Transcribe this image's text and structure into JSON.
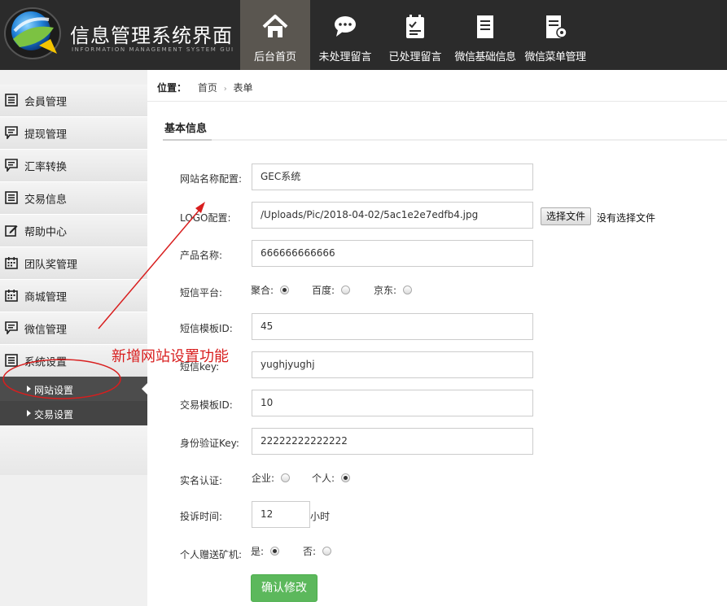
{
  "header": {
    "title": "信息管理系统界面",
    "subtitle": "INFORMATION MANAGEMENT SYSTEM GUI",
    "nav": [
      {
        "label": "后台首页",
        "icon": "home-icon",
        "active": true
      },
      {
        "label": "未处理留言",
        "icon": "chat-icon",
        "active": false
      },
      {
        "label": "已处理留言",
        "icon": "checklist-icon",
        "active": false
      },
      {
        "label": "微信基础信息",
        "icon": "document-icon",
        "active": false
      },
      {
        "label": "微信菜单管理",
        "icon": "doc-settings-icon",
        "active": false
      }
    ]
  },
  "sidebar": {
    "items": [
      {
        "label": "会員管理",
        "icon": "list-icon"
      },
      {
        "label": "提现管理",
        "icon": "comment-icon"
      },
      {
        "label": "汇率转换",
        "icon": "comment-icon"
      },
      {
        "label": "交易信息",
        "icon": "list-icon"
      },
      {
        "label": "帮助中心",
        "icon": "edit-icon"
      },
      {
        "label": "团队奖管理",
        "icon": "calendar-icon"
      },
      {
        "label": "商城管理",
        "icon": "calendar-icon"
      },
      {
        "label": "微信管理",
        "icon": "comment-icon"
      },
      {
        "label": "系统设置",
        "icon": "list-icon"
      }
    ],
    "subitems": [
      {
        "label": "网站设置",
        "active": true
      },
      {
        "label": "交易设置",
        "active": false
      }
    ]
  },
  "breadcrumb": {
    "position_label": "位置：",
    "home": "首页",
    "sep": "›",
    "current": "表单"
  },
  "section": {
    "title": "基本信息"
  },
  "form": {
    "site_name": {
      "label": "网站名称配置:",
      "value": "GEC系统"
    },
    "logo": {
      "label": "LOGO配置:",
      "value": "/Uploads/Pic/2018-04-02/5ac1e2e7edfb4.jpg",
      "button": "选择文件",
      "file_status": "没有选择文件"
    },
    "product_name": {
      "label": "产品名称:",
      "value": "666666666666"
    },
    "sms_platform": {
      "label": "短信平台:",
      "options": [
        "聚合:",
        "百度:",
        "京东:"
      ],
      "selected": "聚合:"
    },
    "sms_template": {
      "label": "短信模板ID:",
      "value": "45"
    },
    "sms_key": {
      "label": "短信key:",
      "value": "yughjyughj"
    },
    "trade_template": {
      "label": "交易模板ID:",
      "value": "10"
    },
    "id_key": {
      "label": "身份验证Key:",
      "value": "22222222222222"
    },
    "realname": {
      "label": "实名认证:",
      "options": [
        "企业:",
        "个人:"
      ],
      "selected": "个人:"
    },
    "complaint": {
      "label": "投诉时间:",
      "value": "12",
      "unit": "小时"
    },
    "gift_miner": {
      "label": "个人赠送矿机:",
      "options": [
        "是:",
        "否:"
      ],
      "selected": "是:"
    },
    "submit_label": "确认修改"
  },
  "annotation": {
    "text": "新增网站设置功能",
    "color": "#d81e1e"
  },
  "colors": {
    "header_bg": "#2b2b2b",
    "nav_active": "#5a5650",
    "submit": "#5cb85c"
  }
}
